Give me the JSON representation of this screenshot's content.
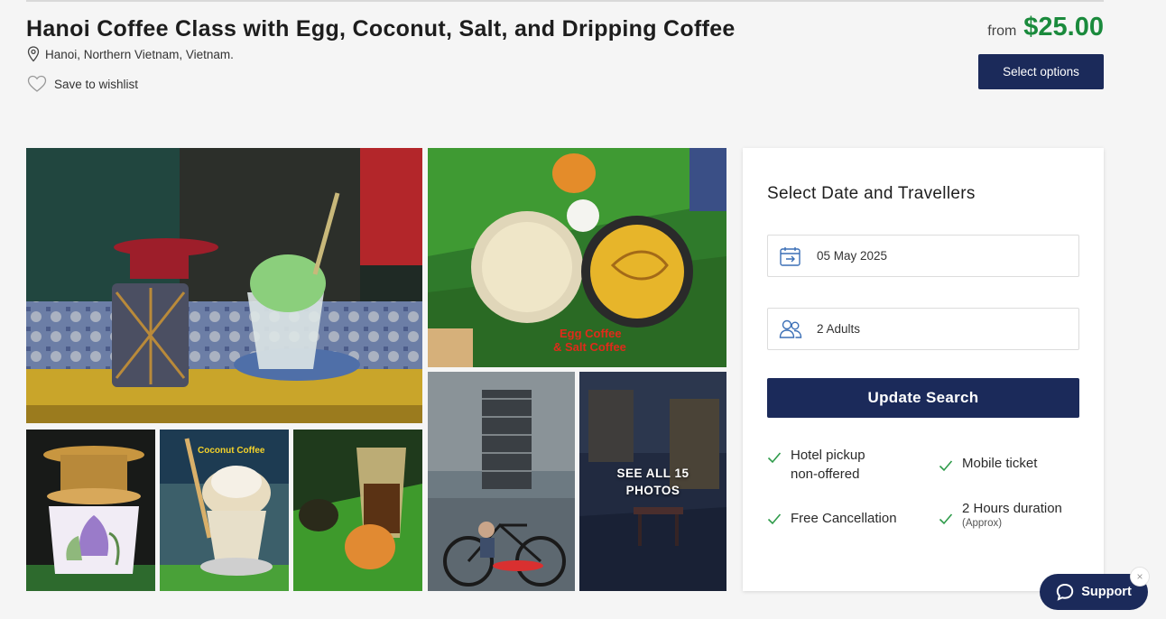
{
  "header": {
    "title": "Hanoi Coffee Class with Egg, Coconut, Salt, and Dripping Coffee",
    "location": "Hanoi, Northern Vietnam, Vietnam.",
    "wishlist_label": "Save to wishlist",
    "price_prefix": "from",
    "price": "$25.00",
    "select_options_label": "Select options"
  },
  "gallery": {
    "photo2_caption_line1": "Egg Coffee",
    "photo2_caption_line2": "& Salt Coffee",
    "photo4_caption": "Coconut Coffee",
    "see_all_line1": "SEE ALL 15",
    "see_all_line2": "PHOTOS"
  },
  "booking": {
    "title": "Select Date and Travellers",
    "date_value": "05 May 2025",
    "travellers_value": "2 Adults",
    "update_label": "Update Search",
    "features": [
      {
        "label": "Hotel pickup",
        "label2": "non-offered"
      },
      {
        "label": "Mobile ticket"
      },
      {
        "label": "Free Cancellation"
      },
      {
        "label": "2 Hours duration",
        "sub": "(Approx)"
      }
    ]
  },
  "support": {
    "label": "Support",
    "close": "×"
  },
  "colors": {
    "navy": "#1b2a5a",
    "price_green": "#1a8a3c",
    "check_green": "#2e9b4a"
  }
}
